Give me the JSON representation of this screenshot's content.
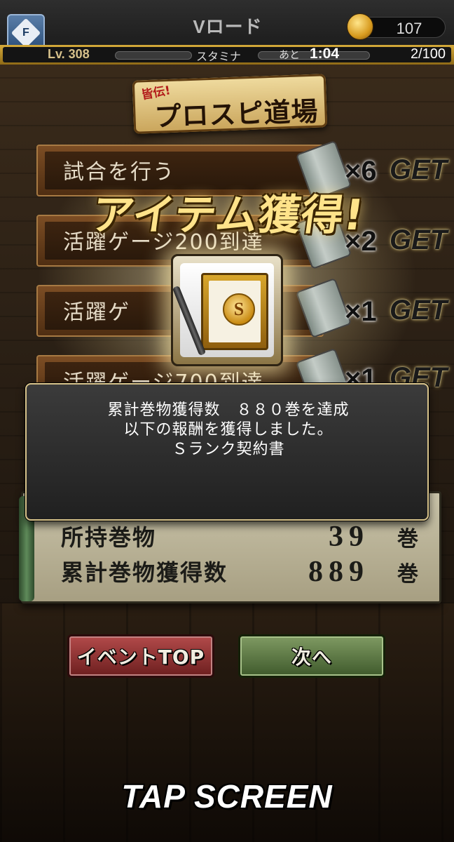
{
  "header": {
    "menu_glyph": "F",
    "title": "Vロード",
    "currency_value": "107",
    "level": "Lv. 308",
    "stamina_label": "スタミナ",
    "remaining_label": "あと",
    "remaining_time": "1:04",
    "stamina_count": "2/100"
  },
  "banner": {
    "small": "皆伝!",
    "main": "プロスピ道場"
  },
  "missions": [
    {
      "label": "試合を行う",
      "count": "×6",
      "get": "GET"
    },
    {
      "label": "活躍ゲージ200到達",
      "count": "×2",
      "get": "GET"
    },
    {
      "label": "活躍ゲ",
      "count": "×1",
      "get": "GET"
    },
    {
      "label": "活躍ゲージ700到達",
      "count": "×1",
      "get": "GET"
    }
  ],
  "overlay": {
    "title": "アイテム獲得!",
    "item_emblem": "S"
  },
  "dialog": {
    "line1": "累計巻物獲得数　８８０巻を達成",
    "line2": "以下の報酬を獲得しました。",
    "line3": "Ｓランク契約書"
  },
  "results": [
    {
      "label": "所持巻物",
      "value": "39",
      "unit": "巻"
    },
    {
      "label": "累計巻物獲得数",
      "value": "889",
      "unit": "巻"
    }
  ],
  "buttons": {
    "event_top": "イベントTOP",
    "next": "次へ"
  },
  "footer": {
    "tap_screen": "TAP SCREEN"
  }
}
